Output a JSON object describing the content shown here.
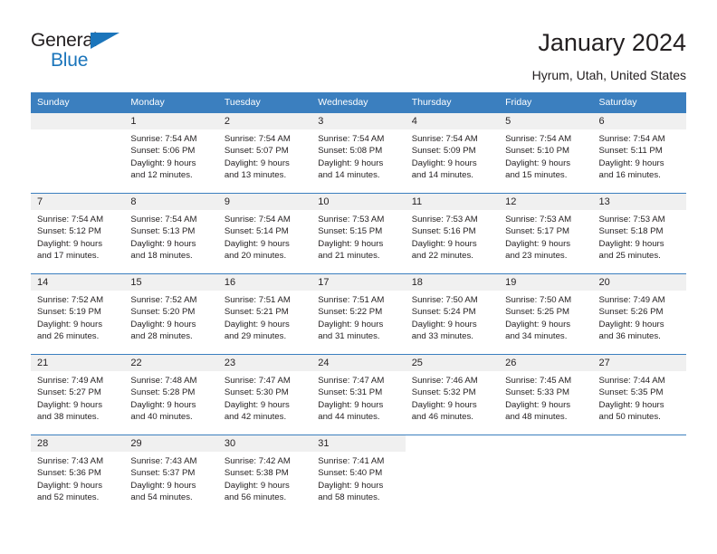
{
  "brand": {
    "name_top": "General",
    "name_bottom": "Blue",
    "accent_color": "#1b75bb"
  },
  "header": {
    "title": "January 2024",
    "subtitle": "Hyrum, Utah, United States"
  },
  "calendar": {
    "header_bg": "#3b7fbf",
    "daynum_bg": "#f0f0f0",
    "weekdays": [
      "Sunday",
      "Monday",
      "Tuesday",
      "Wednesday",
      "Thursday",
      "Friday",
      "Saturday"
    ],
    "weeks": [
      [
        {
          "day": "",
          "sunrise": "",
          "sunset": "",
          "daylight1": "",
          "daylight2": "",
          "empty": true
        },
        {
          "day": "1",
          "sunrise": "Sunrise: 7:54 AM",
          "sunset": "Sunset: 5:06 PM",
          "daylight1": "Daylight: 9 hours",
          "daylight2": "and 12 minutes."
        },
        {
          "day": "2",
          "sunrise": "Sunrise: 7:54 AM",
          "sunset": "Sunset: 5:07 PM",
          "daylight1": "Daylight: 9 hours",
          "daylight2": "and 13 minutes."
        },
        {
          "day": "3",
          "sunrise": "Sunrise: 7:54 AM",
          "sunset": "Sunset: 5:08 PM",
          "daylight1": "Daylight: 9 hours",
          "daylight2": "and 14 minutes."
        },
        {
          "day": "4",
          "sunrise": "Sunrise: 7:54 AM",
          "sunset": "Sunset: 5:09 PM",
          "daylight1": "Daylight: 9 hours",
          "daylight2": "and 14 minutes."
        },
        {
          "day": "5",
          "sunrise": "Sunrise: 7:54 AM",
          "sunset": "Sunset: 5:10 PM",
          "daylight1": "Daylight: 9 hours",
          "daylight2": "and 15 minutes."
        },
        {
          "day": "6",
          "sunrise": "Sunrise: 7:54 AM",
          "sunset": "Sunset: 5:11 PM",
          "daylight1": "Daylight: 9 hours",
          "daylight2": "and 16 minutes."
        }
      ],
      [
        {
          "day": "7",
          "sunrise": "Sunrise: 7:54 AM",
          "sunset": "Sunset: 5:12 PM",
          "daylight1": "Daylight: 9 hours",
          "daylight2": "and 17 minutes."
        },
        {
          "day": "8",
          "sunrise": "Sunrise: 7:54 AM",
          "sunset": "Sunset: 5:13 PM",
          "daylight1": "Daylight: 9 hours",
          "daylight2": "and 18 minutes."
        },
        {
          "day": "9",
          "sunrise": "Sunrise: 7:54 AM",
          "sunset": "Sunset: 5:14 PM",
          "daylight1": "Daylight: 9 hours",
          "daylight2": "and 20 minutes."
        },
        {
          "day": "10",
          "sunrise": "Sunrise: 7:53 AM",
          "sunset": "Sunset: 5:15 PM",
          "daylight1": "Daylight: 9 hours",
          "daylight2": "and 21 minutes."
        },
        {
          "day": "11",
          "sunrise": "Sunrise: 7:53 AM",
          "sunset": "Sunset: 5:16 PM",
          "daylight1": "Daylight: 9 hours",
          "daylight2": "and 22 minutes."
        },
        {
          "day": "12",
          "sunrise": "Sunrise: 7:53 AM",
          "sunset": "Sunset: 5:17 PM",
          "daylight1": "Daylight: 9 hours",
          "daylight2": "and 23 minutes."
        },
        {
          "day": "13",
          "sunrise": "Sunrise: 7:53 AM",
          "sunset": "Sunset: 5:18 PM",
          "daylight1": "Daylight: 9 hours",
          "daylight2": "and 25 minutes."
        }
      ],
      [
        {
          "day": "14",
          "sunrise": "Sunrise: 7:52 AM",
          "sunset": "Sunset: 5:19 PM",
          "daylight1": "Daylight: 9 hours",
          "daylight2": "and 26 minutes."
        },
        {
          "day": "15",
          "sunrise": "Sunrise: 7:52 AM",
          "sunset": "Sunset: 5:20 PM",
          "daylight1": "Daylight: 9 hours",
          "daylight2": "and 28 minutes."
        },
        {
          "day": "16",
          "sunrise": "Sunrise: 7:51 AM",
          "sunset": "Sunset: 5:21 PM",
          "daylight1": "Daylight: 9 hours",
          "daylight2": "and 29 minutes."
        },
        {
          "day": "17",
          "sunrise": "Sunrise: 7:51 AM",
          "sunset": "Sunset: 5:22 PM",
          "daylight1": "Daylight: 9 hours",
          "daylight2": "and 31 minutes."
        },
        {
          "day": "18",
          "sunrise": "Sunrise: 7:50 AM",
          "sunset": "Sunset: 5:24 PM",
          "daylight1": "Daylight: 9 hours",
          "daylight2": "and 33 minutes."
        },
        {
          "day": "19",
          "sunrise": "Sunrise: 7:50 AM",
          "sunset": "Sunset: 5:25 PM",
          "daylight1": "Daylight: 9 hours",
          "daylight2": "and 34 minutes."
        },
        {
          "day": "20",
          "sunrise": "Sunrise: 7:49 AM",
          "sunset": "Sunset: 5:26 PM",
          "daylight1": "Daylight: 9 hours",
          "daylight2": "and 36 minutes."
        }
      ],
      [
        {
          "day": "21",
          "sunrise": "Sunrise: 7:49 AM",
          "sunset": "Sunset: 5:27 PM",
          "daylight1": "Daylight: 9 hours",
          "daylight2": "and 38 minutes."
        },
        {
          "day": "22",
          "sunrise": "Sunrise: 7:48 AM",
          "sunset": "Sunset: 5:28 PM",
          "daylight1": "Daylight: 9 hours",
          "daylight2": "and 40 minutes."
        },
        {
          "day": "23",
          "sunrise": "Sunrise: 7:47 AM",
          "sunset": "Sunset: 5:30 PM",
          "daylight1": "Daylight: 9 hours",
          "daylight2": "and 42 minutes."
        },
        {
          "day": "24",
          "sunrise": "Sunrise: 7:47 AM",
          "sunset": "Sunset: 5:31 PM",
          "daylight1": "Daylight: 9 hours",
          "daylight2": "and 44 minutes."
        },
        {
          "day": "25",
          "sunrise": "Sunrise: 7:46 AM",
          "sunset": "Sunset: 5:32 PM",
          "daylight1": "Daylight: 9 hours",
          "daylight2": "and 46 minutes."
        },
        {
          "day": "26",
          "sunrise": "Sunrise: 7:45 AM",
          "sunset": "Sunset: 5:33 PM",
          "daylight1": "Daylight: 9 hours",
          "daylight2": "and 48 minutes."
        },
        {
          "day": "27",
          "sunrise": "Sunrise: 7:44 AM",
          "sunset": "Sunset: 5:35 PM",
          "daylight1": "Daylight: 9 hours",
          "daylight2": "and 50 minutes."
        }
      ],
      [
        {
          "day": "28",
          "sunrise": "Sunrise: 7:43 AM",
          "sunset": "Sunset: 5:36 PM",
          "daylight1": "Daylight: 9 hours",
          "daylight2": "and 52 minutes."
        },
        {
          "day": "29",
          "sunrise": "Sunrise: 7:43 AM",
          "sunset": "Sunset: 5:37 PM",
          "daylight1": "Daylight: 9 hours",
          "daylight2": "and 54 minutes."
        },
        {
          "day": "30",
          "sunrise": "Sunrise: 7:42 AM",
          "sunset": "Sunset: 5:38 PM",
          "daylight1": "Daylight: 9 hours",
          "daylight2": "and 56 minutes."
        },
        {
          "day": "31",
          "sunrise": "Sunrise: 7:41 AM",
          "sunset": "Sunset: 5:40 PM",
          "daylight1": "Daylight: 9 hours",
          "daylight2": "and 58 minutes."
        },
        {
          "day": "",
          "sunrise": "",
          "sunset": "",
          "daylight1": "",
          "daylight2": "",
          "empty": true,
          "blank": true
        },
        {
          "day": "",
          "sunrise": "",
          "sunset": "",
          "daylight1": "",
          "daylight2": "",
          "empty": true,
          "blank": true
        },
        {
          "day": "",
          "sunrise": "",
          "sunset": "",
          "daylight1": "",
          "daylight2": "",
          "empty": true,
          "blank": true
        }
      ]
    ]
  }
}
